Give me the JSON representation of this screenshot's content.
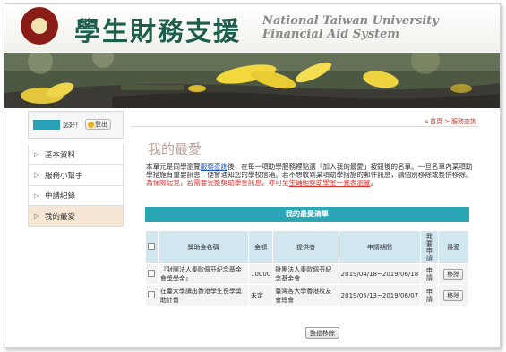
{
  "header": {
    "title_cn": "學生財務支援",
    "title_en_line1": "National Taiwan University",
    "title_en_line2": "Financial Aid System"
  },
  "user": {
    "greeting": "您好！",
    "logout_label": "登出"
  },
  "sidebar": {
    "items": [
      {
        "label": "基本資料",
        "active": false
      },
      {
        "label": "服務小幫手",
        "active": false
      },
      {
        "label": "申請紀錄",
        "active": false
      },
      {
        "label": "我的最愛",
        "active": true
      }
    ]
  },
  "breadcrumb": {
    "home": "首頁",
    "sep": ">",
    "current": "服務查詢"
  },
  "page": {
    "title": "我的最愛",
    "intro_1": "本單元是同學瀏覽",
    "intro_link_1": "服務查詢",
    "intro_2": "後，在每一項助學服務裡點選「加入我的最愛」按鈕後的名單。一旦名單內某項助學措施有重要訊息，便會通知您的學校信箱。若不想收到某項助學措施的郵件訊息，請個別移除或整併移除。",
    "intro_warn": "為保險起見，若需要完整獎助學金訊息，亦可至",
    "intro_link_2": "生輔組獎助學金一覽表瀏覽",
    "intro_end": "。"
  },
  "favorites": {
    "header": "我的最愛清單",
    "columns": {
      "name": "獎助金名稱",
      "amount": "金額",
      "provider": "提供者",
      "period": "申請期間",
      "apply": "我要申請",
      "fav": "最愛"
    },
    "rows": [
      {
        "name": "『財團法人秦歐佩芬紀念基金會獎學金』",
        "amount": "10000",
        "provider": "財團法人秦歐佩芬紀念基金會",
        "period": "2019/04/18~2019/06/18",
        "apply": "申請",
        "remove": "移除"
      },
      {
        "name": "在臺大學讀出香港學生長學獎助計畫",
        "amount": "未定",
        "provider": "臺灣各大學香港校友會總會",
        "period": "2019/05/13~2019/06/07",
        "apply": "申請",
        "remove": "移除"
      }
    ],
    "batch_remove": "整批移除"
  }
}
